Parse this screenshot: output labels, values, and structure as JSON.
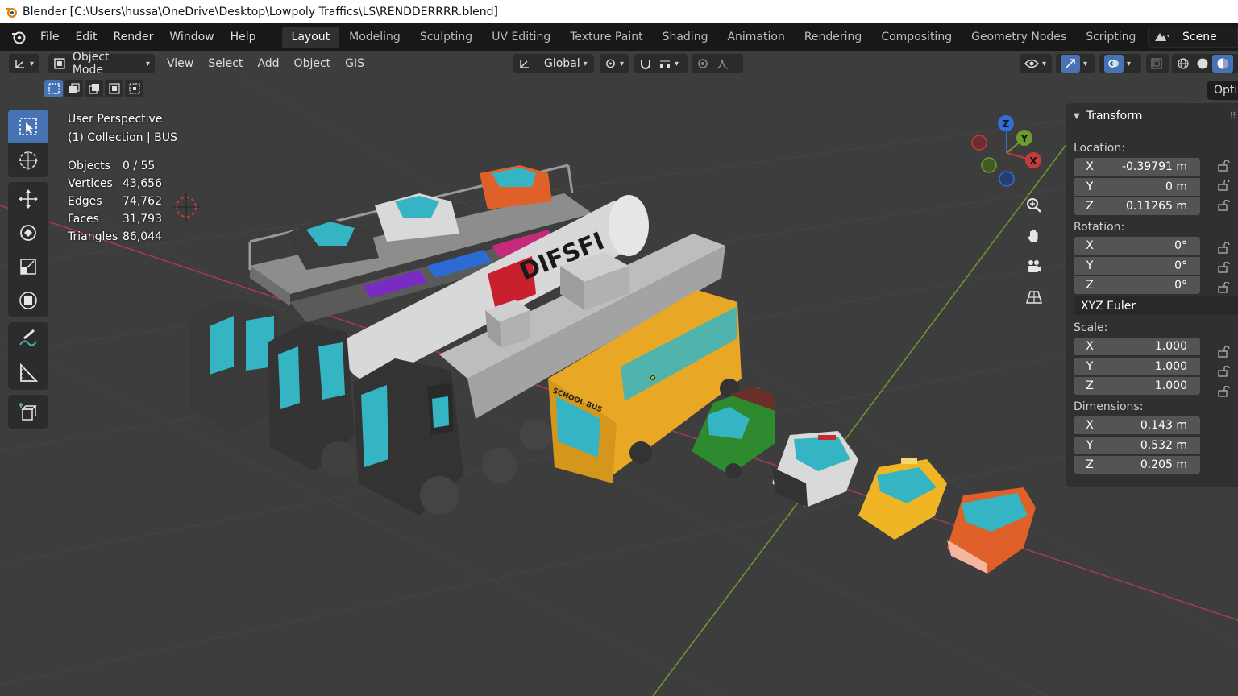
{
  "window": {
    "title": "Blender [C:\\Users\\hussa\\OneDrive\\Desktop\\Lowpoly Traffics\\LS\\RENDDERRRR.blend]"
  },
  "menus": [
    "File",
    "Edit",
    "Render",
    "Window",
    "Help"
  ],
  "workspaces": [
    "Layout",
    "Modeling",
    "Sculpting",
    "UV Editing",
    "Texture Paint",
    "Shading",
    "Animation",
    "Rendering",
    "Compositing",
    "Geometry Nodes",
    "Scripting"
  ],
  "active_workspace": "Layout",
  "scene": {
    "label": "Scene"
  },
  "viewport_header": {
    "mode": "Object Mode",
    "menus": [
      "View",
      "Select",
      "Add",
      "Object",
      "GIS"
    ],
    "orientation": "Global"
  },
  "overlay": {
    "perspective": "User Perspective",
    "collection": "(1) Collection | BUS",
    "stats": [
      {
        "label": "Objects",
        "value": "0 / 55"
      },
      {
        "label": "Vertices",
        "value": "43,656"
      },
      {
        "label": "Edges",
        "value": "74,762"
      },
      {
        "label": "Faces",
        "value": "31,793"
      },
      {
        "label": "Triangles",
        "value": "86,044"
      }
    ]
  },
  "scene_labels": {
    "tanker_brand": "DIFSFI",
    "bus_sign": "SCHOOL BUS"
  },
  "gizmo": {
    "z": "Z",
    "y": "Y",
    "x": "X"
  },
  "npanel": {
    "tab": "Optic",
    "section": "Transform",
    "location_label": "Location:",
    "location": [
      {
        "axis": "X",
        "value": "-0.39791 m"
      },
      {
        "axis": "Y",
        "value": "0 m"
      },
      {
        "axis": "Z",
        "value": "0.11265 m"
      }
    ],
    "rotation_label": "Rotation:",
    "rotation": [
      {
        "axis": "X",
        "value": "0°"
      },
      {
        "axis": "Y",
        "value": "0°"
      },
      {
        "axis": "Z",
        "value": "0°"
      }
    ],
    "rotation_mode": "XYZ Euler",
    "scale_label": "Scale:",
    "scale": [
      {
        "axis": "X",
        "value": "1.000"
      },
      {
        "axis": "Y",
        "value": "1.000"
      },
      {
        "axis": "Z",
        "value": "1.000"
      }
    ],
    "dimensions_label": "Dimensions:",
    "dimensions": [
      {
        "axis": "X",
        "value": "0.143 m"
      },
      {
        "axis": "Y",
        "value": "0.532 m"
      },
      {
        "axis": "Z",
        "value": "0.205 m"
      }
    ]
  },
  "colors": {
    "accent": "#4772b3",
    "grid_x": "#a83d47",
    "grid_y": "#6a9d2c",
    "bus": "#e8a826",
    "car_green": "#2d8a2e",
    "car_orange": "#e0602a",
    "taxi": "#f0b524"
  }
}
